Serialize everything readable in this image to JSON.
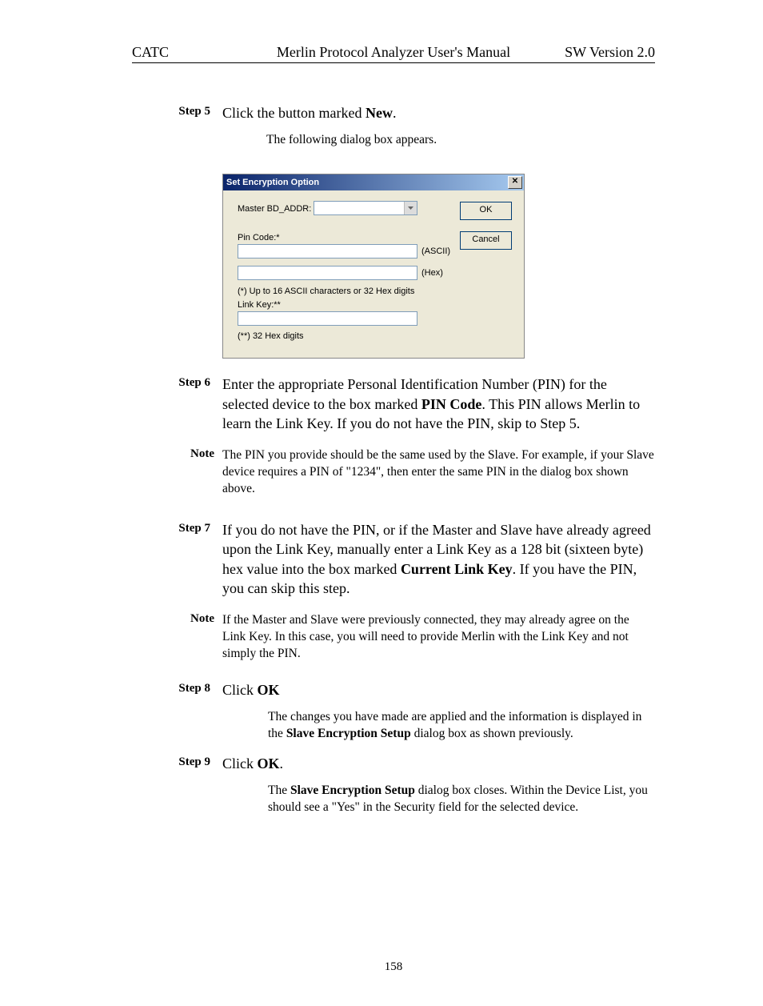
{
  "header": {
    "left": "CATC",
    "center": "Merlin Protocol Analyzer User's Manual",
    "right": "SW Version 2.0"
  },
  "step5": {
    "label": "Step 5",
    "text_pre": "Click the button marked ",
    "text_bold": "New",
    "text_post": ".",
    "sub": "The following dialog box appears."
  },
  "dialog": {
    "title": "Set Encryption Option",
    "close": "✕",
    "master_label": "Master BD_ADDR:",
    "pin_label": "Pin Code:*",
    "ascii": "(ASCII)",
    "hex": "(Hex)",
    "asterisk_note": "(*) Up to 16 ASCII characters or 32 Hex digits",
    "linkkey_label": "Link Key:**",
    "linkkey_note": "(**) 32 Hex digits",
    "ok": "OK",
    "cancel": "Cancel"
  },
  "step6": {
    "label": "Step 6",
    "seg1": "Enter the appropriate Personal Identification Number (PIN) for the selected device to the box marked ",
    "bold1": "PIN Code",
    "seg2": ".  This PIN allows Merlin to learn the Link Key.  If you do not have the PIN, skip to Step 5."
  },
  "note6": {
    "label": "Note",
    "text": "The PIN you provide should be the same used by the Slave.  For example, if your Slave device requires a PIN of \"1234\", then enter the same PIN in the dialog box shown above."
  },
  "step7": {
    "label": "Step 7",
    "seg1": "If you do not have the PIN, or if the Master and Slave have already agreed upon the Link Key, manually enter a Link Key as a 128 bit (sixteen byte) hex value into the box marked ",
    "bold1": "Current Link Key",
    "seg2": ".  If you have the PIN, you can skip this step."
  },
  "note7": {
    "label": "Note",
    "text": "If the Master and Slave were previously connected, they may already agree on the Link Key.  In this case, you will need to provide Merlin with the Link Key and not simply the PIN."
  },
  "step8": {
    "label": "Step 8",
    "pre": "Click ",
    "bold": "OK",
    "sub_seg1": "The changes you have made are applied and the information is displayed in the ",
    "sub_bold": "Slave Encryption Setup",
    "sub_seg2": " dialog box as shown previously."
  },
  "step9": {
    "label": "Step 9",
    "pre": "Click ",
    "bold": "OK",
    "post": ".",
    "sub_seg1": "The ",
    "sub_bold": "Slave Encryption Setup",
    "sub_seg2": " dialog box closes.  Within the Device List, you should see a \"Yes\" in the Security field for the selected device."
  },
  "pageno": "158"
}
